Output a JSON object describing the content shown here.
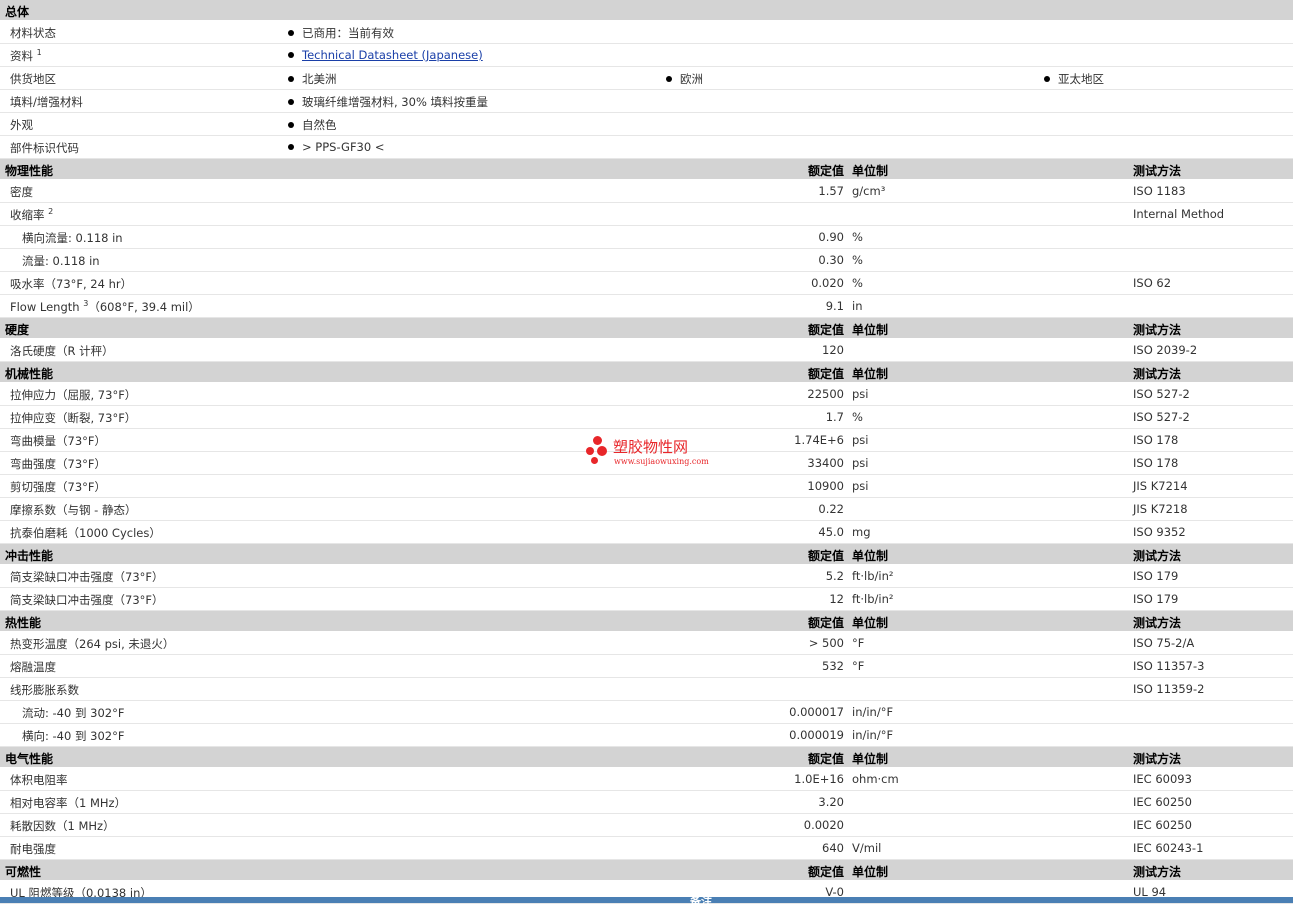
{
  "general": {
    "title": "总体",
    "rows": [
      {
        "label": "材料状态",
        "values": [
          "已商用：当前有效"
        ]
      },
      {
        "label": "资料",
        "sup": "1",
        "link": "Technical Datasheet (Japanese)"
      },
      {
        "label": "供货地区",
        "values": [
          "北美洲",
          "欧洲",
          "亚太地区"
        ]
      },
      {
        "label": "填料/增强材料",
        "values": [
          "玻璃纤维增强材料, 30% 填料按重量"
        ]
      },
      {
        "label": "外观",
        "values": [
          "自然色"
        ]
      },
      {
        "label": "部件标识代码",
        "values": [
          "> PPS-GF30 <"
        ]
      }
    ]
  },
  "headers": {
    "value": "额定值",
    "unit": "单位制",
    "test": "测试方法"
  },
  "sections": [
    {
      "title": "物理性能",
      "rows": [
        {
          "label": "密度",
          "value": "1.57",
          "unit": "g/cm³",
          "test": "ISO 1183"
        },
        {
          "label": "收缩率",
          "sup": "2",
          "value": "",
          "unit": "",
          "test": "Internal Method"
        },
        {
          "label": "横向流量: 0.118 in",
          "sub": true,
          "value": "0.90",
          "unit": "%",
          "test": ""
        },
        {
          "label": "流量: 0.118 in",
          "sub": true,
          "value": "0.30",
          "unit": "%",
          "test": ""
        },
        {
          "label": "吸水率（73°F, 24 hr）",
          "value": "0.020",
          "unit": "%",
          "test": "ISO 62"
        },
        {
          "label": "Flow Length",
          "sup": "3",
          "label_tail": "（608°F, 39.4 mil）",
          "value": "9.1",
          "unit": "in",
          "test": ""
        }
      ]
    },
    {
      "title": "硬度",
      "rows": [
        {
          "label": "洛氏硬度（R 计秤）",
          "value": "120",
          "unit": "",
          "test": "ISO 2039-2"
        }
      ]
    },
    {
      "title": "机械性能",
      "rows": [
        {
          "label": "拉伸应力（屈服, 73°F）",
          "value": "22500",
          "unit": "psi",
          "test": "ISO 527-2"
        },
        {
          "label": "拉伸应变（断裂, 73°F）",
          "value": "1.7",
          "unit": "%",
          "test": "ISO 527-2"
        },
        {
          "label": "弯曲模量（73°F）",
          "value": "1.74E+6",
          "unit": "psi",
          "test": "ISO 178"
        },
        {
          "label": "弯曲强度（73°F）",
          "value": "33400",
          "unit": "psi",
          "test": "ISO 178"
        },
        {
          "label": "剪切强度（73°F）",
          "value": "10900",
          "unit": "psi",
          "test": "JIS K7214"
        },
        {
          "label": "摩擦系数（与钢 - 静态）",
          "value": "0.22",
          "unit": "",
          "test": "JIS K7218"
        },
        {
          "label": "抗泰伯磨耗（1000 Cycles）",
          "value": "45.0",
          "unit": "mg",
          "test": "ISO 9352"
        }
      ]
    },
    {
      "title": "冲击性能",
      "rows": [
        {
          "label": "简支梁缺口冲击强度（73°F）",
          "value": "5.2",
          "unit": "ft·lb/in²",
          "test": "ISO 179"
        },
        {
          "label": "简支梁缺口冲击强度（73°F）",
          "value": "12",
          "unit": "ft·lb/in²",
          "test": "ISO 179"
        }
      ]
    },
    {
      "title": "热性能",
      "rows": [
        {
          "label": "热变形温度（264 psi, 未退火）",
          "value": "> 500",
          "unit": "°F",
          "test": "ISO 75-2/A"
        },
        {
          "label": "熔融温度",
          "value": "532",
          "unit": "°F",
          "test": "ISO 11357-3"
        },
        {
          "label": "线形膨胀系数",
          "value": "",
          "unit": "",
          "test": "ISO 11359-2"
        },
        {
          "label": "流动: -40 到 302°F",
          "sub": true,
          "value": "0.000017",
          "unit": "in/in/°F",
          "test": ""
        },
        {
          "label": "横向: -40 到 302°F",
          "sub": true,
          "value": "0.000019",
          "unit": "in/in/°F",
          "test": ""
        }
      ]
    },
    {
      "title": "电气性能",
      "rows": [
        {
          "label": "体积电阻率",
          "value": "1.0E+16",
          "unit": "ohm·cm",
          "test": "IEC 60093"
        },
        {
          "label": "相对电容率（1 MHz）",
          "value": "3.20",
          "unit": "",
          "test": "IEC 60250"
        },
        {
          "label": "耗散因数（1 MHz）",
          "value": "0.0020",
          "unit": "",
          "test": "IEC 60250"
        },
        {
          "label": "耐电强度",
          "value": "640",
          "unit": "V/mil",
          "test": "IEC 60243-1"
        }
      ]
    },
    {
      "title": "可燃性",
      "rows": [
        {
          "label": "UL 阻燃等级（0.0138 in）",
          "value": "V-0",
          "unit": "",
          "test": "UL 94"
        }
      ]
    }
  ],
  "watermark": {
    "title": "塑胶物性网",
    "url": "www.sujiaowuxing.com",
    "color": "#e8262a"
  },
  "footer": {
    "label": "备注"
  }
}
